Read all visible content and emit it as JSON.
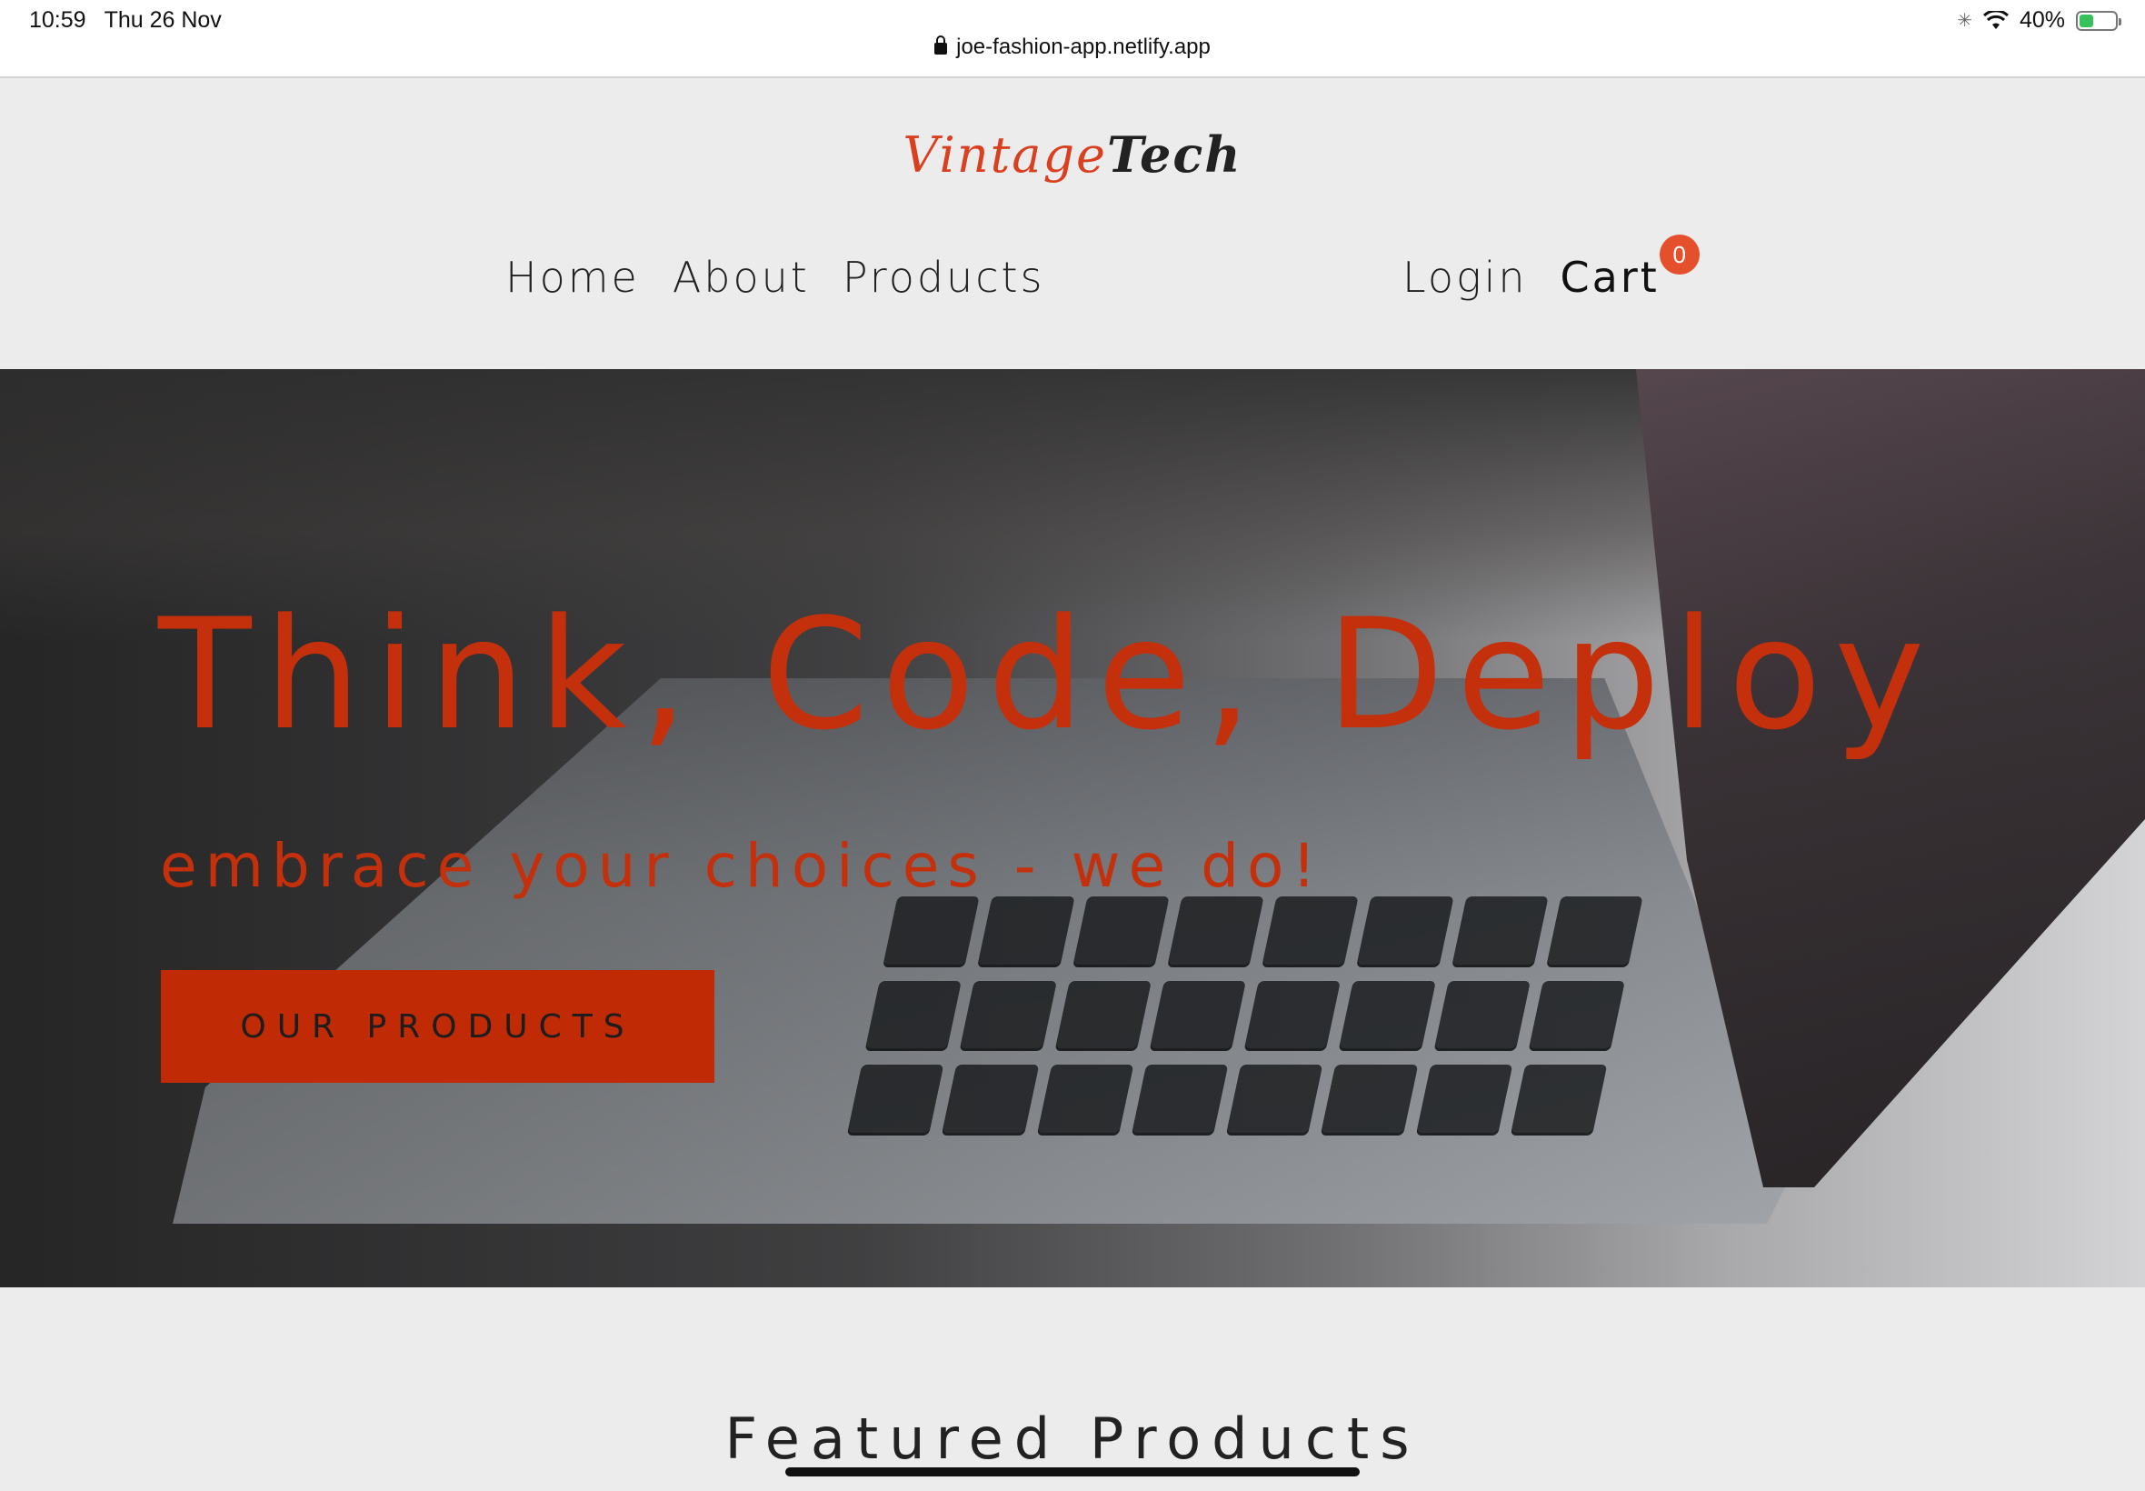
{
  "status_bar": {
    "time": "10:59",
    "date": "Thu 26 Nov",
    "battery": "40%",
    "battery_level": 0.4
  },
  "browser": {
    "url": "joe-fashion-app.netlify.app"
  },
  "header": {
    "logo_part1": "Vintage",
    "logo_part2": "Tech",
    "nav_left": [
      "Home",
      "About",
      "Products"
    ],
    "login_label": "Login",
    "cart_label": "Cart",
    "cart_count": "0"
  },
  "hero": {
    "title": "Think, Code, Deploy",
    "subtitle": "embrace your choices - we do!",
    "cta_label": "OUR PRODUCTS"
  },
  "featured": {
    "title": "Featured Products"
  },
  "colors": {
    "accent": "#c4300c",
    "badge": "#e5502c",
    "background": "#ececec"
  }
}
